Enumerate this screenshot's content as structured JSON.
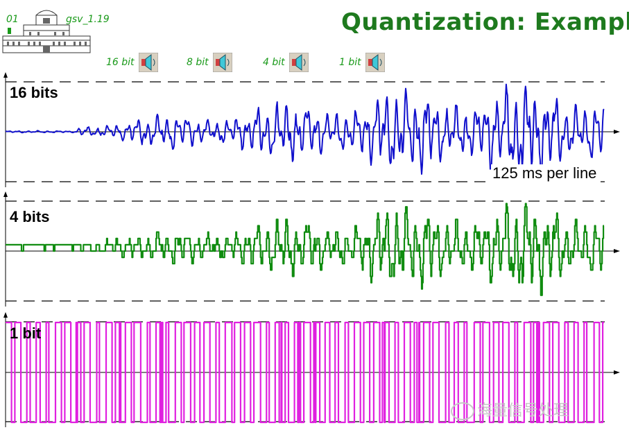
{
  "header": {
    "title": "Quantization: Example",
    "slide_number": "01",
    "version": "gsv_1.19"
  },
  "audio_buttons": [
    {
      "label": "16 bit",
      "icon": "speaker-icon"
    },
    {
      "label": "8 bit",
      "icon": "speaker-icon"
    },
    {
      "label": "4 bit",
      "icon": "speaker-icon"
    },
    {
      "label": "1 bit",
      "icon": "speaker-icon"
    }
  ],
  "panels": [
    {
      "label": "16 bits",
      "color": "#1010cc"
    },
    {
      "label": "4 bits",
      "color": "#108c10"
    },
    {
      "label": "1 bit",
      "color": "#e020e0"
    }
  ],
  "annotation": "125 ms per line",
  "watermark": "海量信号处理"
}
